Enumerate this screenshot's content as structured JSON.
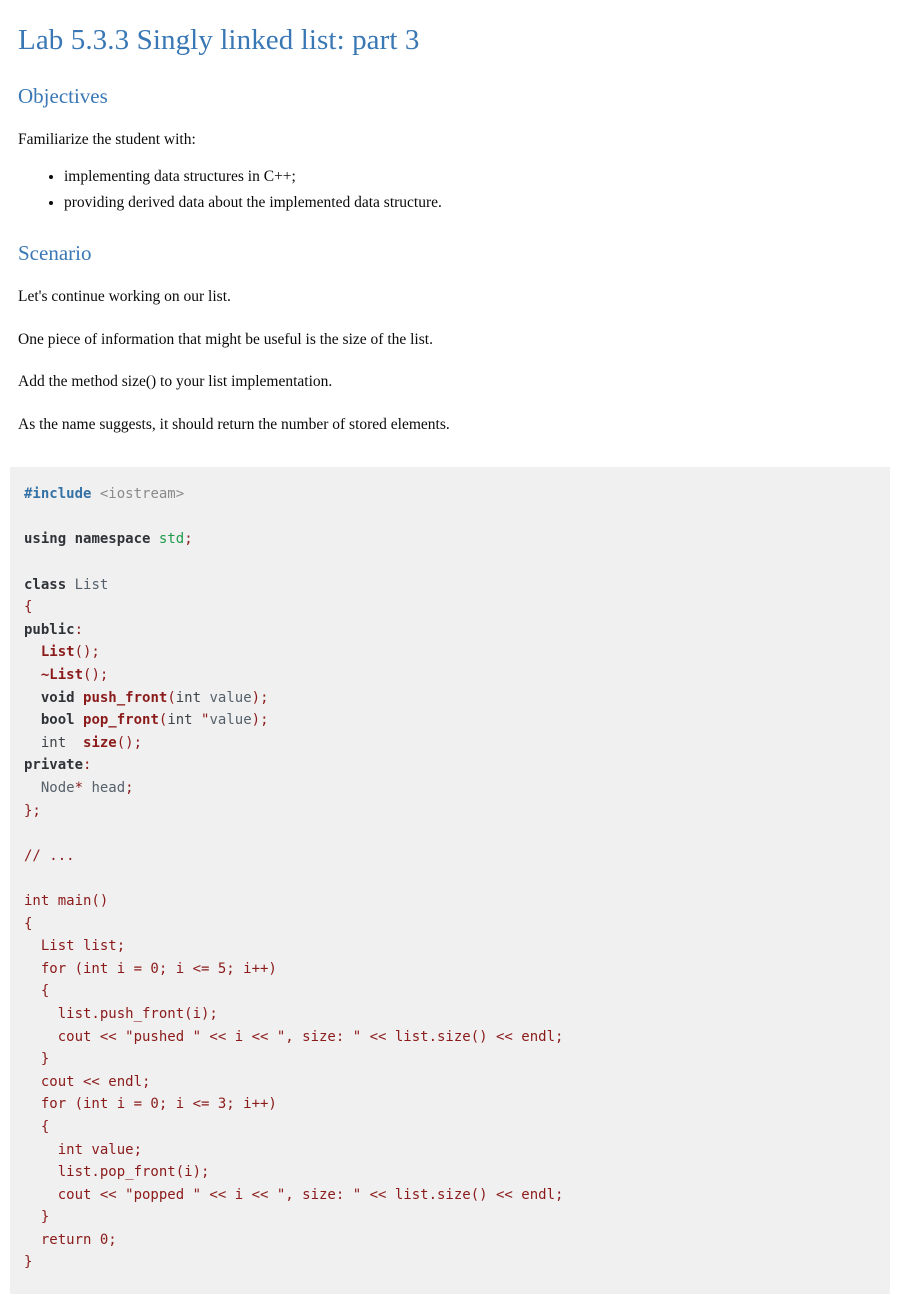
{
  "document": {
    "title": "Lab 5.3.3 Singly linked list: part 3",
    "sections": [
      {
        "heading": "Objectives",
        "intro": "Familiarize the student with:",
        "bullets": [
          "implementing data structures in C++;",
          "providing derived data about the implemented data structure."
        ]
      },
      {
        "heading": "Scenario",
        "paragraphs": [
          "Let's continue working on our list.",
          "One piece of information that might be useful is the size of the list.",
          "Add the method size() to your list implementation.",
          "As the name suggests, it should return the number of stored elements."
        ]
      }
    ]
  },
  "code": {
    "language": "cpp",
    "lines": [
      "#include <iostream>",
      "",
      "using namespace std;",
      "",
      "class List",
      "{",
      "public:",
      "  List();",
      "  ~List();",
      "  void push_front(int value);",
      "  bool pop_front(int \"value);",
      "  int  size();",
      "private:",
      "  Node* head;",
      "};",
      "",
      "// ...",
      "",
      "int main()",
      "{",
      "  List list;",
      "  for (int i = 0; i <= 5; i++)",
      "  {",
      "    list.push_front(i);",
      "    cout << \"pushed \" << i << \", size: \" << list.size() << endl;",
      "  }",
      "  cout << endl;",
      "  for (int i = 0; i <= 3; i++)",
      "  {",
      "    int value;",
      "    list.pop_front(i);",
      "    cout << \"popped \" << i << \", size: \" << list.size() << endl;",
      "  }",
      "  return 0;",
      "}"
    ]
  },
  "colors": {
    "heading": "#3a78b5",
    "code_background": "#f0f0f0",
    "code_default": "#8b1a1a",
    "preprocessor": "#3572a5",
    "keyword": "#2f3337",
    "namespace": "#1f9a4a",
    "include_path": "#8a8a8a",
    "page_background": "#ffffff",
    "body_text": "#0a0a0a"
  }
}
